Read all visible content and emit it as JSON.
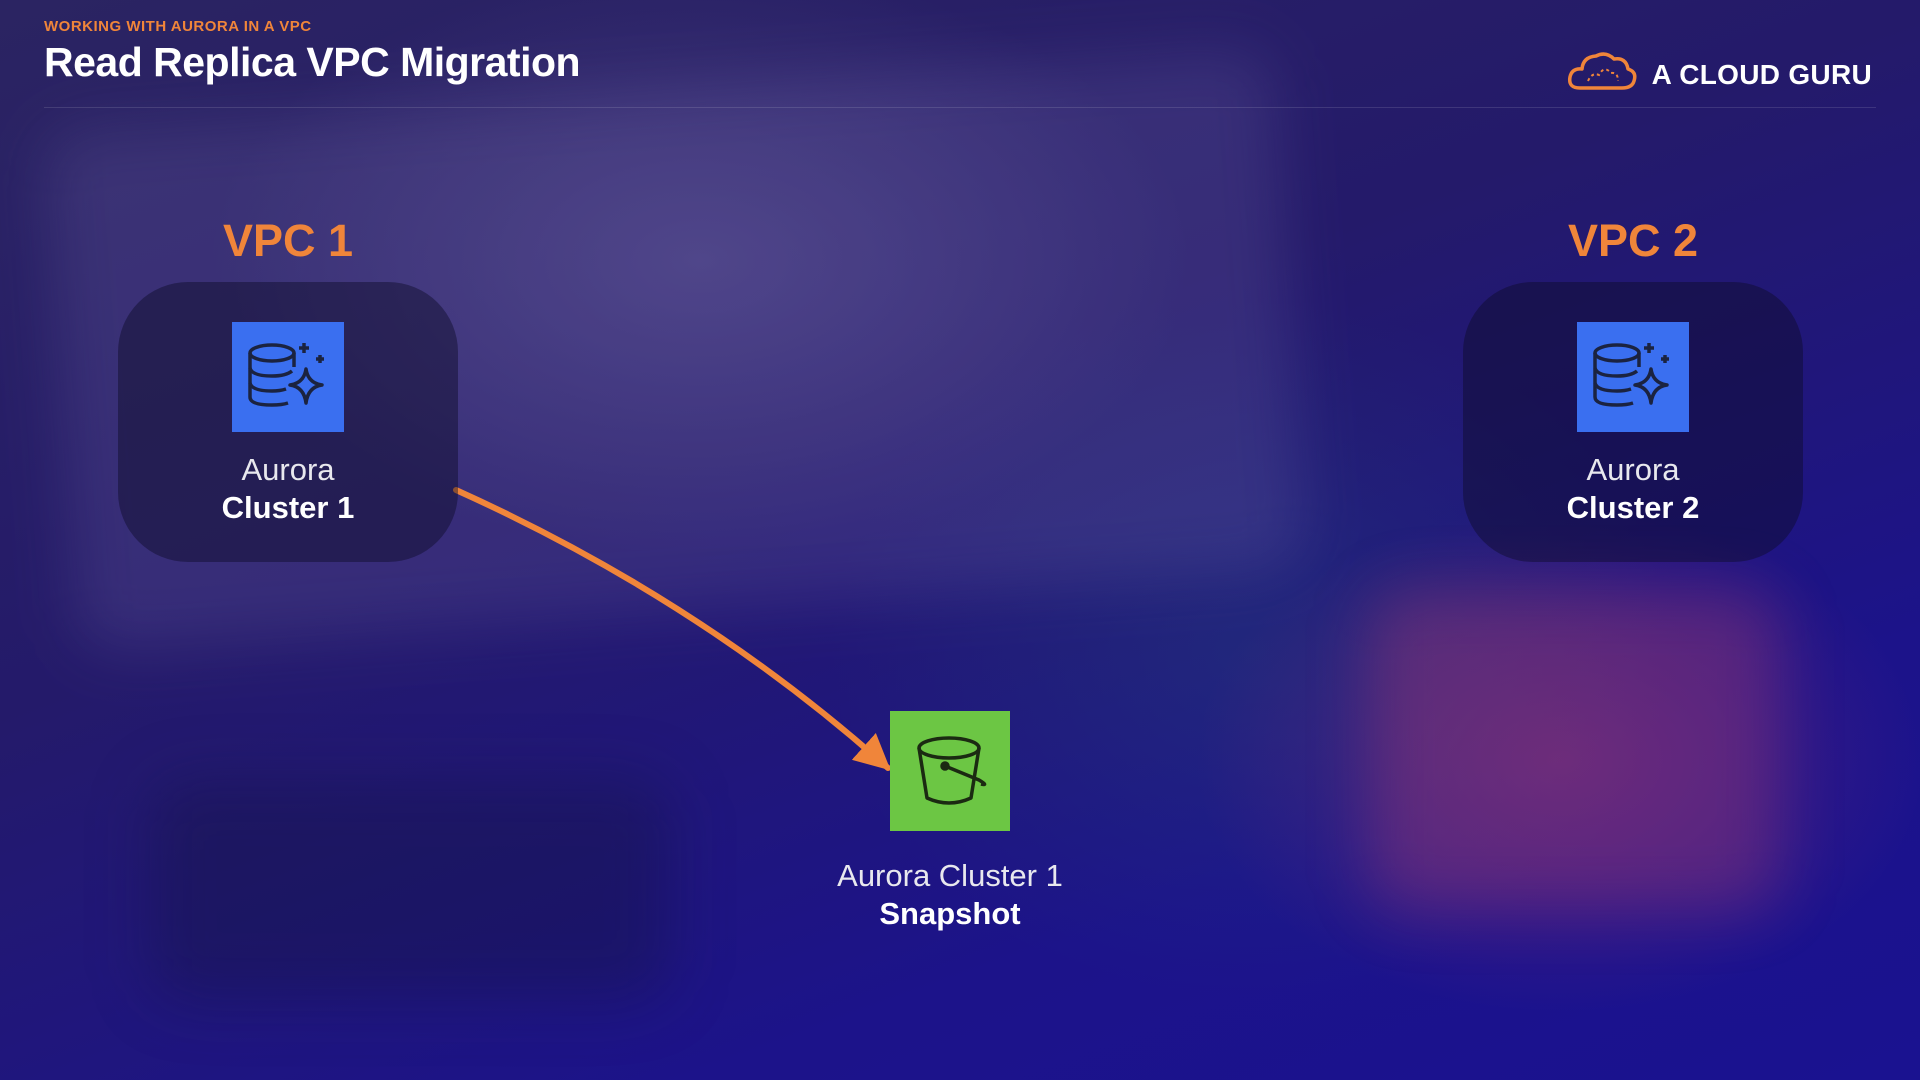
{
  "header": {
    "eyebrow": "WORKING WITH AURORA IN A VPC",
    "title": "Read Replica VPC Migration"
  },
  "brand": {
    "name": "A CLOUD GURU",
    "icon": "cloud-logo-icon"
  },
  "colors": {
    "accent": "#f0853a",
    "aurora_tile": "#3a6ff0",
    "s3_tile": "#6cc644"
  },
  "vpc1": {
    "label": "VPC 1",
    "node": {
      "icon": "aurora-database-icon",
      "line1": "Aurora",
      "line2": "Cluster 1"
    }
  },
  "vpc2": {
    "label": "VPC 2",
    "node": {
      "icon": "aurora-database-icon",
      "line1": "Aurora",
      "line2": "Cluster 2"
    }
  },
  "snapshot": {
    "icon": "s3-bucket-icon",
    "line1": "Aurora Cluster 1",
    "line2": "Snapshot"
  },
  "connections": [
    {
      "from": "vpc1",
      "to": "snapshot"
    }
  ]
}
